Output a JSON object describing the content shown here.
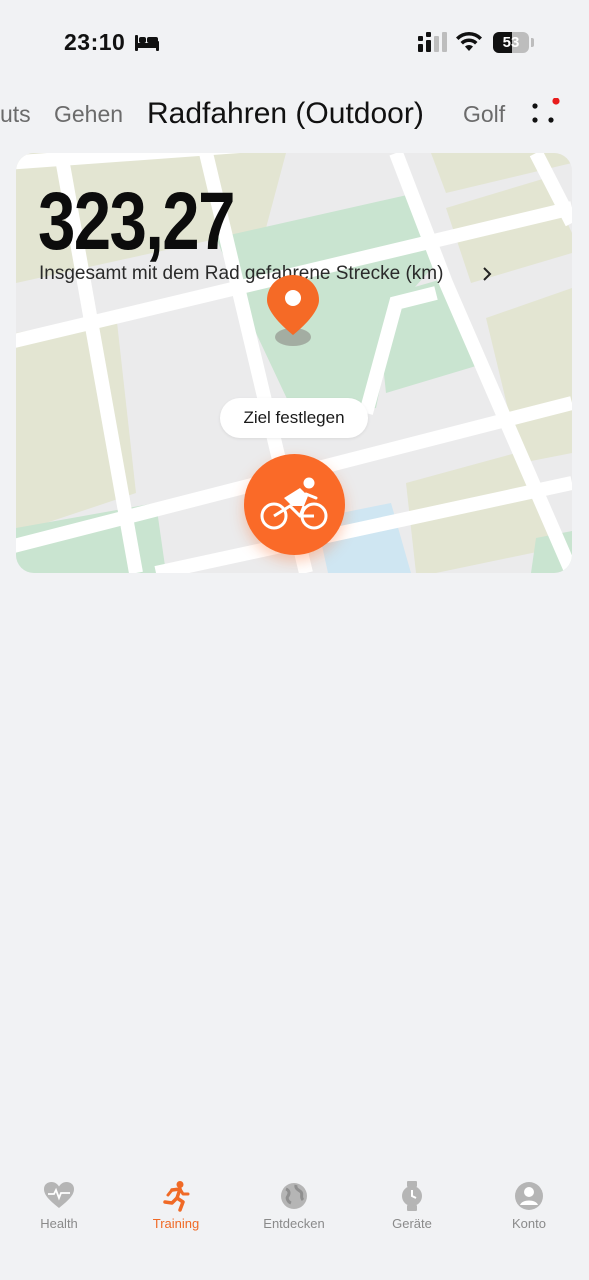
{
  "status_bar": {
    "time": "23:10",
    "battery_level": "53",
    "battery_fraction": 0.53
  },
  "tabs": [
    {
      "label": "uts"
    },
    {
      "label": "Gehen"
    },
    {
      "label": "Radfahren (Outdoor)",
      "active": true
    },
    {
      "label": "Golf"
    }
  ],
  "card": {
    "distance": "323,27",
    "distance_label": "Insgesamt mit dem Rad gefahrene Strecke (km)",
    "goal_button": "Ziel festlegen"
  },
  "bottom_nav": [
    {
      "label": "Health",
      "icon": "heart-pulse-icon"
    },
    {
      "label": "Training",
      "icon": "running-icon",
      "active": true
    },
    {
      "label": "Entdecken",
      "icon": "globe-icon"
    },
    {
      "label": "Geräte",
      "icon": "watch-icon"
    },
    {
      "label": "Konto",
      "icon": "person-icon"
    }
  ],
  "colors": {
    "accent": "#fa6a28",
    "background": "#f1f2f4",
    "map_green": "#c9e4d0",
    "map_beige": "#e3e5d2",
    "map_water": "#cfe6f2"
  }
}
